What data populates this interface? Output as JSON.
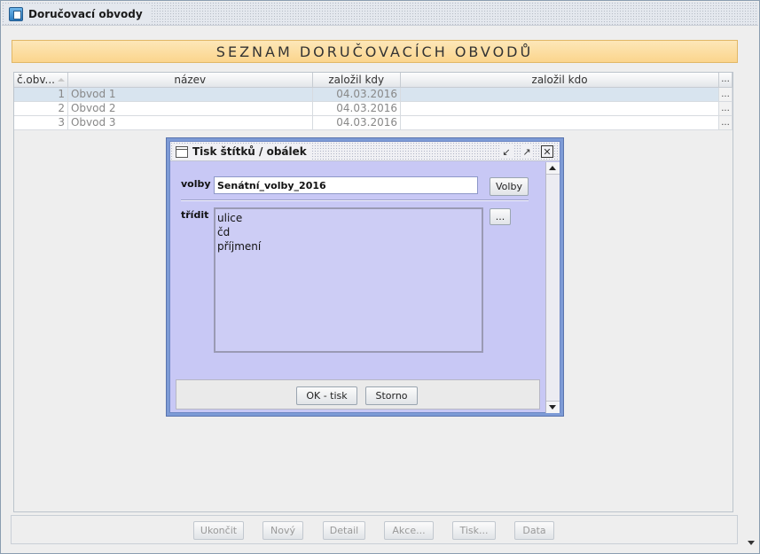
{
  "window": {
    "title": "Doručovací obvody"
  },
  "banner": {
    "text": "SEZNAM DORUČOVACÍCH OBVODŮ"
  },
  "table": {
    "columns": [
      "č.obv...",
      "název",
      "založil kdy",
      "založil kdo",
      "..."
    ],
    "rows": [
      {
        "num": "1",
        "name": "Obvod 1",
        "created": "04.03.2016",
        "by": "",
        "more": "..."
      },
      {
        "num": "2",
        "name": "Obvod 2",
        "created": "04.03.2016",
        "by": "",
        "more": "..."
      },
      {
        "num": "3",
        "name": "Obvod 3",
        "created": "04.03.2016",
        "by": "",
        "more": "..."
      }
    ],
    "selected_row": 1
  },
  "toolbar": {
    "buttons": [
      "Ukončit",
      "Nový",
      "Detail",
      "Akce...",
      "Tisk...",
      "Data"
    ]
  },
  "dialog": {
    "title": "Tisk štítků / obálek",
    "volby_label": "volby",
    "volby_value": "Senátní_volby_2016",
    "volby_button": "Volby",
    "tridit_label": "třídit",
    "tridit_button": "...",
    "sort_items": [
      "ulice",
      "čd",
      "příjmení"
    ],
    "ok_button": "OK - tisk",
    "cancel_button": "Storno"
  },
  "colors": {
    "banner_bg": "#fbd58d",
    "dialog_body": "#c8c8f5",
    "dialog_frame": "#7d9bd6",
    "selected_row": "#d8e4ef"
  }
}
